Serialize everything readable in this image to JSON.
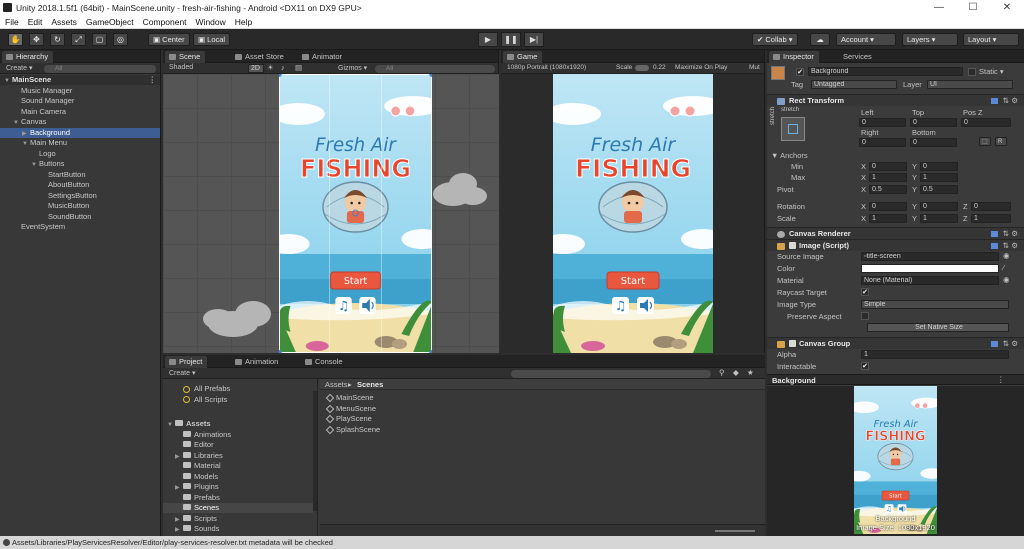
{
  "title_bar": {
    "title": "Unity 2018.1.5f1 (64bit) - MainScene.unity - fresh-air-fishing - Android <DX11 on DX9 GPU>",
    "minimize": "—",
    "maximize": "☐",
    "close": "✕"
  },
  "menu": [
    "File",
    "Edit",
    "Assets",
    "GameObject",
    "Component",
    "Window",
    "Help"
  ],
  "toolbar": {
    "pivot": "Center",
    "space": "Local",
    "collab": "Collab ▾",
    "account": "Account ▾",
    "layers": "Layers ▾",
    "layout": "Layout ▾",
    "icons": [
      "hand-icon",
      "move-icon",
      "rotate-icon",
      "scale-icon",
      "rect-icon",
      "transform-icon"
    ]
  },
  "hierarchy": {
    "tab": "Hierarchy",
    "create": "Create ▾",
    "search": "All",
    "rows": [
      {
        "label": "MainScene",
        "depth": 0,
        "expanded": true,
        "style": "scene"
      },
      {
        "label": "Music Manager",
        "depth": 1
      },
      {
        "label": "Sound Manager",
        "depth": 1
      },
      {
        "label": "Main Camera",
        "depth": 1
      },
      {
        "label": "Canvas",
        "depth": 1,
        "expanded": true
      },
      {
        "label": "Background",
        "depth": 2,
        "selected": true,
        "collapsed": true
      },
      {
        "label": "Main Menu",
        "depth": 2,
        "expanded": true
      },
      {
        "label": "Logo",
        "depth": 3
      },
      {
        "label": "Buttons",
        "depth": 3,
        "expanded": true
      },
      {
        "label": "StartButton",
        "depth": 4
      },
      {
        "label": "AboutButton",
        "depth": 4
      },
      {
        "label": "SettingsButton",
        "depth": 4
      },
      {
        "label": "MusicButton",
        "depth": 4
      },
      {
        "label": "SoundButton",
        "depth": 4
      },
      {
        "label": "EventSystem",
        "depth": 1
      }
    ]
  },
  "scene": {
    "tabs": [
      "Scene",
      "Asset Store",
      "Animator"
    ],
    "shading": "Shaded",
    "mode_2d": "2D",
    "gizmos": "Gizmos ▾",
    "search": "All"
  },
  "game": {
    "tab": "Game",
    "resolution": "1080p Portrait (1080x1920)",
    "scale_label": "Scale",
    "scale_value": "0.22",
    "maximize": "Maximize On Play",
    "mute": "Mut"
  },
  "game_art": {
    "logo_top": "Fresh Air",
    "logo_bottom": "FISHING",
    "start": "Start",
    "colors": {
      "sky": "#7fcdea",
      "water": "#4fb0d8",
      "logo_red": "#e8452c",
      "logo_blue": "#2c7ab0",
      "button": "#e9573f",
      "sand": "#f0dfa6"
    }
  },
  "inspector": {
    "tabs": [
      "Inspector",
      "Services"
    ],
    "object_name": "Background",
    "static_label": "Static ▾",
    "tag_label": "Tag",
    "tag_value": "Untagged",
    "layer_label": "Layer",
    "layer_value": "UI",
    "rect": {
      "header": "Rect Transform",
      "anchor_side": "stretch",
      "anchor_top": "stretch",
      "left_label": "Left",
      "top_label": "Top",
      "posz_label": "Pos Z",
      "left": "0",
      "top": "0",
      "posz": "0",
      "right_label": "Right",
      "bottom_label": "Bottom",
      "right": "0",
      "bottom": "0",
      "r_button": "R",
      "anchors_label": "Anchors",
      "min_label": "Min",
      "max_label": "Max",
      "min_x": "0",
      "min_y": "0",
      "max_x": "1",
      "max_y": "1",
      "pivot_label": "Pivot",
      "pivot_x": "0.5",
      "pivot_y": "0.5",
      "rotation_label": "Rotation",
      "rot_x": "0",
      "rot_y": "0",
      "rot_z": "0",
      "scale_label": "Scale",
      "scale_x": "1",
      "scale_y": "1",
      "scale_z": "1",
      "axis_x": "X",
      "axis_y": "Y",
      "axis_z": "Z"
    },
    "canvas_renderer": "Canvas Renderer",
    "image": {
      "header": "Image (Script)",
      "source_label": "Source Image",
      "source_value": "title-screen",
      "color_label": "Color",
      "material_label": "Material",
      "material_value": "None (Material)",
      "raycast_label": "Raycast Target",
      "type_label": "Image Type",
      "type_value": "Simple",
      "preserve_label": "Preserve Aspect",
      "native_button": "Set Native Size"
    },
    "canvas_group": {
      "header": "Canvas Group",
      "alpha_label": "Alpha",
      "alpha_value": "1",
      "interactable_label": "Interactable"
    },
    "preview_title": "Background",
    "preview_caption1": "Background",
    "preview_caption2": "Image Size: 1080x1920"
  },
  "project": {
    "tabs": [
      "Project",
      "Animation",
      "Console"
    ],
    "create": "Create ▾",
    "favorites": [
      "All Prefabs",
      "All Scripts"
    ],
    "assets_root": "Assets",
    "folders": [
      "Animations",
      "Editor",
      "Libraries",
      "Material",
      "Models",
      "Plugins",
      "Prefabs",
      "Scenes",
      "Scripts",
      "Sounds"
    ],
    "selected_folder": "Scenes",
    "breadcrumb": [
      "Assets",
      "Scenes"
    ],
    "files": [
      "MainScene",
      "MenuScene",
      "PlayScene",
      "SplashScene"
    ]
  },
  "status": "Assets/Libraries/PlayServicesResolver/Editor/play-services-resolver.txt metadata will be checked"
}
